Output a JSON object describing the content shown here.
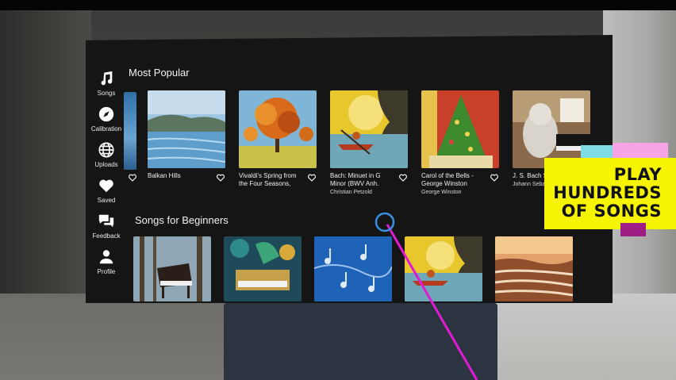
{
  "sidebar": {
    "items": [
      {
        "label": "Songs",
        "icon": "music-note-icon"
      },
      {
        "label": "Calibration",
        "icon": "compass-icon"
      },
      {
        "label": "Uploads",
        "icon": "globe-icon"
      },
      {
        "label": "Saved",
        "icon": "heart-icon"
      },
      {
        "label": "Feedback",
        "icon": "chat-icon"
      },
      {
        "label": "Profile",
        "icon": "person-icon"
      }
    ]
  },
  "most_popular": {
    "title": "Most Popular",
    "cards": [
      {
        "title": "Balkan Hills",
        "artist": "",
        "art": "lake-hills"
      },
      {
        "title": "Vivaldi's Spring from the Four Seasons,",
        "artist": "",
        "art": "autumn-tree"
      },
      {
        "title": "Bach: Minuet in G Minor (BWV Anh.",
        "artist": "Christian Petzold",
        "art": "canoe"
      },
      {
        "title": "Carol of the Bells - George Winston",
        "artist": "George Winston",
        "art": "christmas-tree"
      },
      {
        "title": "J. S. Bach Suite n° 1",
        "artist": "Johann Seba",
        "art": "cat-piano"
      }
    ]
  },
  "beginners": {
    "title": "Songs for Beginners",
    "cards": [
      {
        "art": "forest-piano"
      },
      {
        "art": "peacock-piano"
      },
      {
        "art": "blue-notes"
      },
      {
        "art": "canoe"
      },
      {
        "art": "sunset-shore"
      }
    ]
  },
  "promo": {
    "lines": [
      "PLAY",
      "HUNDREDS",
      "OF SONGS"
    ]
  },
  "colors": {
    "panel": "#151515",
    "promo_yellow": "#f7f400",
    "laser": "#e21ad6",
    "cursor": "#3a8fe0"
  }
}
